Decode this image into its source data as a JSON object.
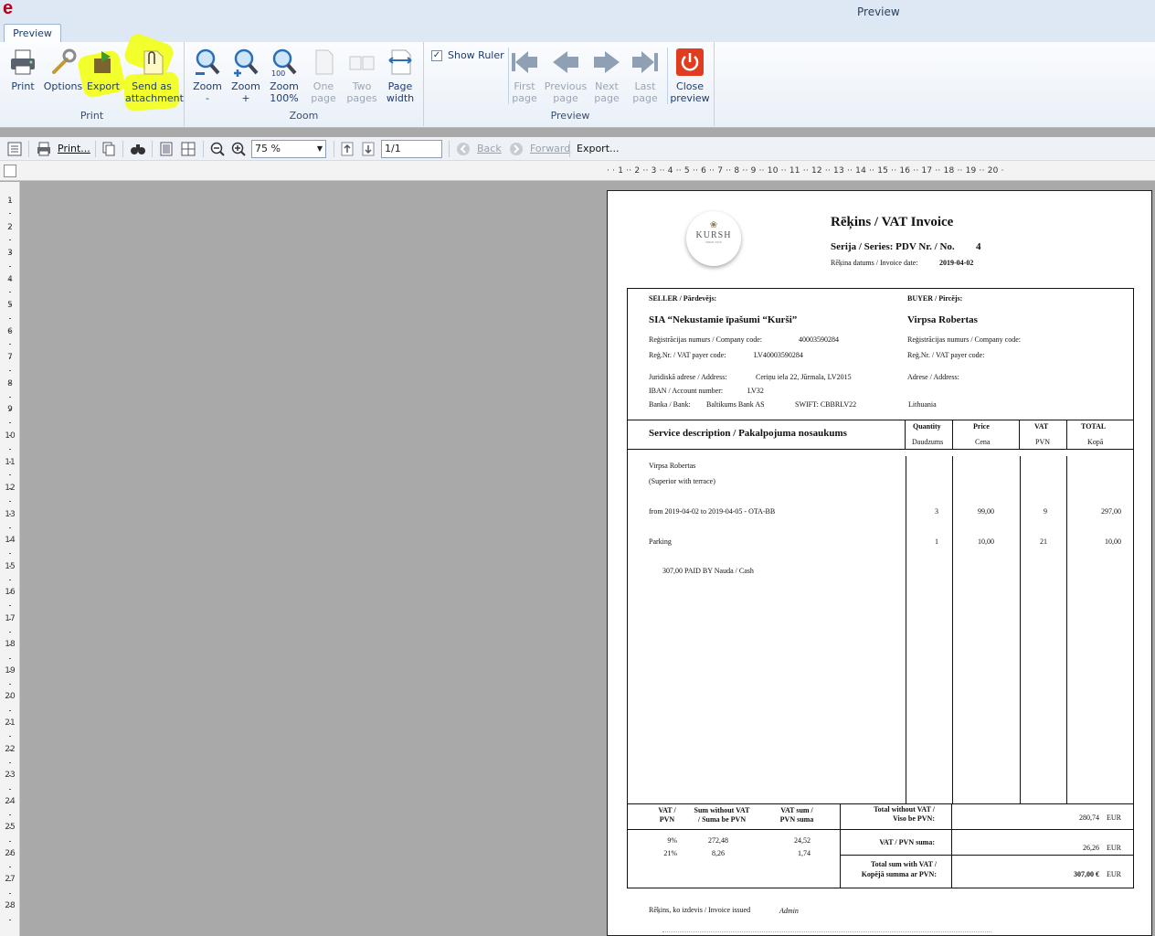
{
  "app": {
    "title": "Preview",
    "tab": "Preview"
  },
  "ribbon": {
    "print_group": {
      "label": "Print",
      "buttons": [
        {
          "l1": "Print",
          "l2": ""
        },
        {
          "l1": "Options",
          "l2": ""
        },
        {
          "l1": "Export",
          "l2": ""
        },
        {
          "l1": "Send as",
          "l2": "attachment"
        }
      ]
    },
    "zoom_group": {
      "label": "Zoom",
      "buttons": [
        {
          "l1": "Zoom",
          "l2": "-"
        },
        {
          "l1": "Zoom",
          "l2": "+"
        },
        {
          "l1": "Zoom",
          "l2": "100%"
        },
        {
          "l1": "One",
          "l2": "page"
        },
        {
          "l1": "Two",
          "l2": "pages"
        },
        {
          "l1": "Page",
          "l2": "width"
        }
      ]
    },
    "preview_group": {
      "label": "Preview",
      "show_ruler": "Show Ruler",
      "show_ruler_checked": true,
      "buttons": [
        {
          "l1": "First",
          "l2": "page"
        },
        {
          "l1": "Previous",
          "l2": "page"
        },
        {
          "l1": "Next",
          "l2": "page"
        },
        {
          "l1": "Last",
          "l2": "page"
        },
        {
          "l1": "Close",
          "l2": "preview"
        }
      ]
    },
    "zoom_icon_text": "100"
  },
  "toolbar": {
    "print": "Print...",
    "zoom_value": "75 %",
    "page_value": "1/1",
    "back": "Back",
    "forward": "Forward",
    "export": "Export..."
  },
  "ruler": {
    "h_labels": [
      "1",
      "2",
      "3",
      "4",
      "5",
      "6",
      "7",
      "8",
      "9",
      "10",
      "11",
      "12",
      "13",
      "14",
      "15",
      "16",
      "17",
      "18",
      "19",
      "20"
    ],
    "v_labels": [
      "1",
      "2",
      "3",
      "4",
      "5",
      "6",
      "7",
      "8",
      "9",
      "10",
      "11",
      "12",
      "13",
      "14",
      "15",
      "16",
      "17",
      "18",
      "19",
      "20",
      "21",
      "22",
      "23",
      "24",
      "25",
      "26",
      "27",
      "28"
    ]
  },
  "invoice": {
    "logo_text": "KURSH",
    "logo_sub": "SINCE 2015",
    "title": "Rēķins / VAT Invoice",
    "series_label": "Serija / Series: PDV  Nr. / No.",
    "number": "4",
    "date_label": "Rēķina datums / Invoice date:",
    "date": "2019-04-02",
    "seller": {
      "heading": "SELLER / Pārdevējs:",
      "name": "SIA “Nekustamie īpašumi “Kurši”",
      "reg_label": "Reģistrācijas numurs / Company code:",
      "reg": "40003590284",
      "vat_label": "Reģ.Nr. / VAT payer code:",
      "vat": "LV40003590284",
      "addr_label": "Juridiskā adrese / Address:",
      "addr": "Ceriņu iela 22, Jūrmala, LV2015",
      "iban_label": "IBAN / Account number:",
      "iban": "LV32",
      "bank_label": "Banka / Bank:",
      "bank": "Baltikums Bank AS",
      "swift": "SWIFT: CBBRLV22"
    },
    "buyer": {
      "heading": "BUYER / Pircējs:",
      "name": "Virpsa Robertas",
      "reg_label": "Reģistrācijas numurs / Company code:",
      "vat_label": "Reģ.Nr. / VAT payer code:",
      "addr_label": "Adrese / Address:",
      "country": "Lithuania"
    },
    "columns": {
      "desc": "Service description / Pakalpojuma nosaukums",
      "qty": "Quantity",
      "qty_sub": "Daudzums",
      "price": "Price",
      "price_sub": "Cena",
      "vat": "VAT",
      "vat_sub": "PVN",
      "total": "TOTAL",
      "total_sub": "Kopā"
    },
    "guest_name": "Virpsa Robertas",
    "room_type": "(Superior with terrace)",
    "items": [
      {
        "desc": "from 2019-04-02 to 2019-04-05 - OTA-BB",
        "qty": "3",
        "price": "99,00",
        "vat": "9",
        "total": "297,00"
      },
      {
        "desc": "Parking",
        "qty": "1",
        "price": "10,00",
        "vat": "21",
        "total": "10,00"
      }
    ],
    "paid": "307,00 PAID BY Nauda / Cash",
    "vat_table": {
      "h1": "VAT /",
      "h1b": "PVN",
      "h2": "Sum without VAT",
      "h2b": "/ Suma be PVN",
      "h3": "VAT sum /",
      "h3b": "PVN suma",
      "rows": [
        {
          "rate": "9%",
          "sum": "272,48",
          "vat": "24,52"
        },
        {
          "rate": "21%",
          "sum": "8,26",
          "vat": "1,74"
        }
      ]
    },
    "totals": {
      "no_vat_label1": "Total without VAT /",
      "no_vat_label2": "Viso be PVN:",
      "no_vat": "280,74",
      "vat_label": "VAT / PVN suma:",
      "vat": "26,26",
      "with_vat_label1": "Total sum with VAT /",
      "with_vat_label2": "Kopējā summa ar PVN:",
      "with_vat": "307,00 €",
      "currency": "EUR"
    },
    "issued_label": "Rēķins, ko izdevis / Invoice issued",
    "issued_by": "Admin"
  },
  "colors": {
    "highlight": "#f2ff1b",
    "close": "#e03c1f",
    "ribbon_text": "#1e3c6e"
  }
}
